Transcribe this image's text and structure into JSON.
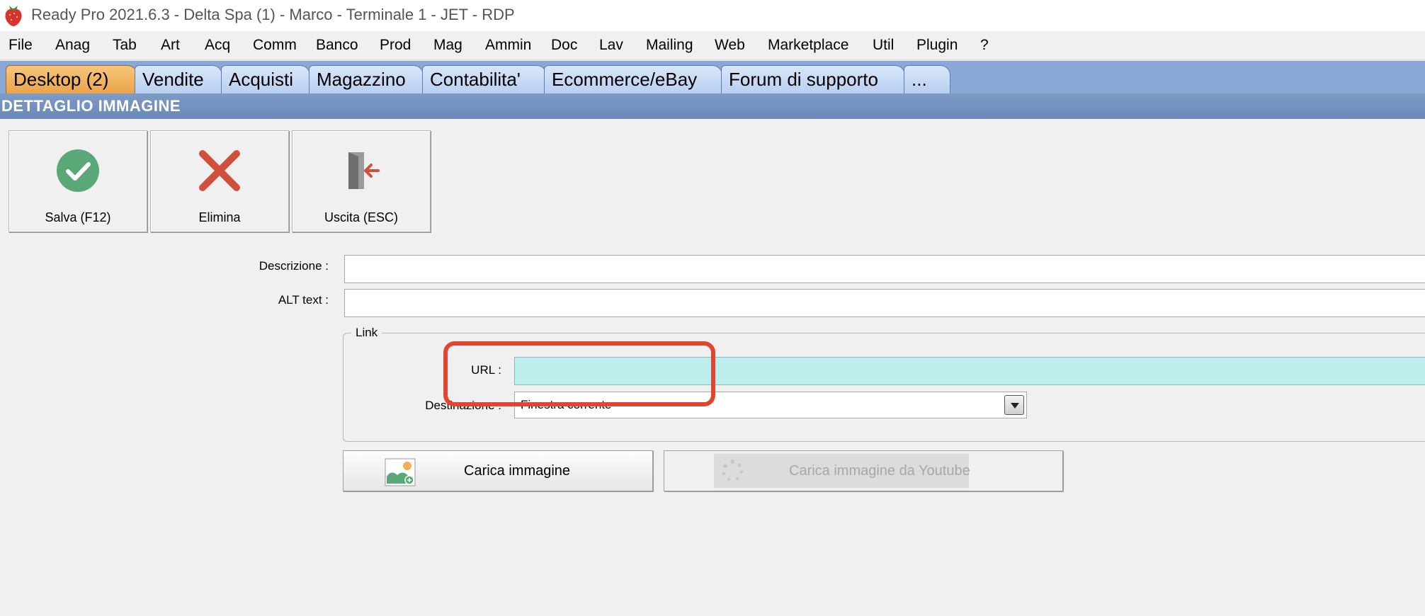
{
  "window": {
    "title": "Ready Pro 2021.6.3 - Delta Spa (1) - Marco - Terminale 1 - JET - RDP"
  },
  "menu": [
    "File",
    "Anag",
    "Tab",
    "Art",
    "Acq",
    "Comm",
    "Banco",
    "Prod",
    "Mag",
    "Ammin",
    "Doc",
    "Lav",
    "Mailing",
    "Web",
    "Marketplace",
    "Util",
    "Plugin",
    "?"
  ],
  "tabs": [
    {
      "label": "Desktop (2)",
      "active": true
    },
    {
      "label": "Vendite",
      "active": false
    },
    {
      "label": "Acquisti",
      "active": false
    },
    {
      "label": "Magazzino",
      "active": false
    },
    {
      "label": "Contabilita'",
      "active": false
    },
    {
      "label": "Ecommerce/eBay",
      "active": false
    },
    {
      "label": "Forum di supporto",
      "active": false
    },
    {
      "label": "...",
      "active": false
    }
  ],
  "section": {
    "title": "DETTAGLIO IMMAGINE"
  },
  "toolbar": {
    "save": {
      "label": "Salva (F12)",
      "icon": "check-circle-icon",
      "color": "#5aa878"
    },
    "delete": {
      "label": "Elimina",
      "icon": "x-icon",
      "color": "#d0503c"
    },
    "exit": {
      "label": "Uscita (ESC)",
      "icon": "exit-door-icon",
      "color": "#d0503c"
    }
  },
  "form": {
    "descrizione": {
      "label": "Descrizione :",
      "value": ""
    },
    "alt_text": {
      "label": "ALT text :",
      "value": ""
    },
    "link": {
      "legend": "Link",
      "url": {
        "label": "URL :",
        "value": ""
      },
      "destinazione": {
        "label": "Destinazione :",
        "value": "Finestra corrente"
      }
    }
  },
  "buttons": {
    "upload_image": {
      "label": "Carica immagine",
      "enabled": true
    },
    "upload_youtube": {
      "label": "Carica immagine da Youtube",
      "enabled": false
    }
  },
  "highlight_color": "#e2452f"
}
